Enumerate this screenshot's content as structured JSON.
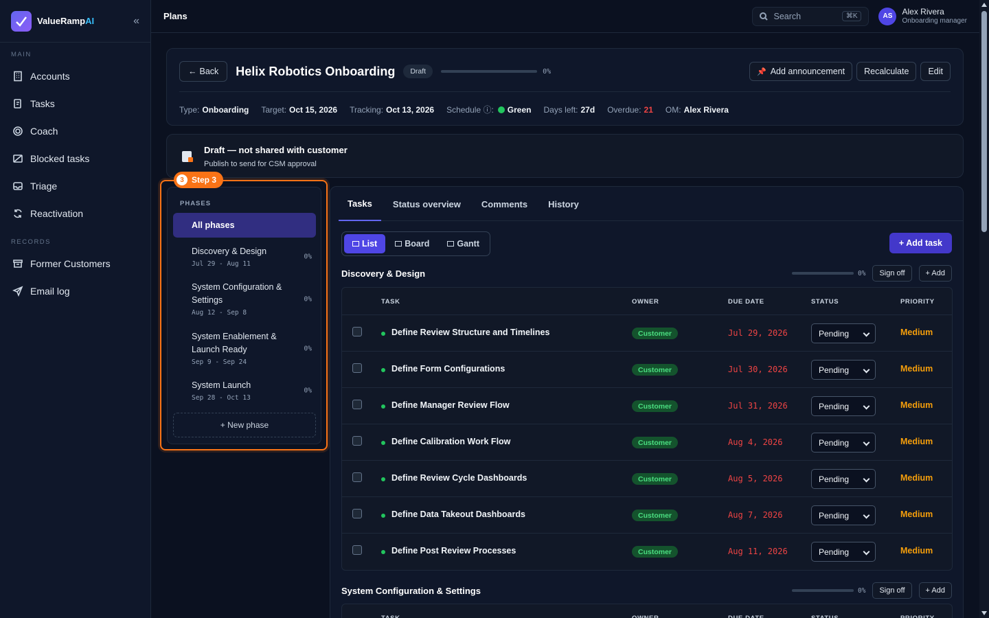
{
  "brand": {
    "name": "ValueRamp",
    "suffix": "AI"
  },
  "sidebar": {
    "section_main": "MAIN",
    "main_items": [
      {
        "label": "Accounts",
        "icon": "building-icon"
      },
      {
        "label": "Tasks",
        "icon": "clipboard-icon"
      },
      {
        "label": "Coach",
        "icon": "target-icon"
      },
      {
        "label": "Blocked tasks",
        "icon": "blocked-icon"
      },
      {
        "label": "Triage",
        "icon": "inbox-icon"
      },
      {
        "label": "Reactivation",
        "icon": "refresh-icon"
      }
    ],
    "section_records": "RECORDS",
    "record_items": [
      {
        "label": "Former Customers",
        "icon": "archive-icon"
      },
      {
        "label": "Email log",
        "icon": "send-icon"
      }
    ]
  },
  "topbar": {
    "title": "Plans",
    "search_placeholder": "Search",
    "search_shortcut": "⌘K",
    "user": {
      "initials": "AS",
      "name": "Alex Rivera",
      "role": "Onboarding manager"
    }
  },
  "plan": {
    "back_label": "Back",
    "title": "Helix Robotics Onboarding",
    "status": "Draft",
    "progress": "0%",
    "actions": {
      "announce": "Add announcement",
      "recalc": "Recalculate",
      "edit": "Edit"
    },
    "meta": {
      "type_label": "Type:",
      "type": "Onboarding",
      "target_label": "Target:",
      "target": "Oct 15, 2026",
      "tracking_label": "Tracking:",
      "tracking": "Oct 13, 2026",
      "schedule_label": "Schedule ⓘ:",
      "schedule": "Green",
      "days_left_label": "Days left:",
      "days_left": "27d",
      "overdue_label": "Overdue:",
      "overdue": "21",
      "om_label": "OM:",
      "om": "Alex Rivera"
    }
  },
  "banner": {
    "title": "Draft — not shared with customer",
    "subtitle": "Publish to send for CSM approval"
  },
  "step": {
    "num": "3",
    "label": "Step 3"
  },
  "phases": {
    "heading": "PHASES",
    "all": "All phases",
    "items": [
      {
        "name": "Discovery & Design",
        "dates": "Jul 29 - Aug 11",
        "pct": "0%"
      },
      {
        "name": "System Configuration & Settings",
        "dates": "Aug 12 - Sep 8",
        "pct": "0%"
      },
      {
        "name": "System Enablement & Launch Ready",
        "dates": "Sep 9 - Sep 24",
        "pct": "0%"
      },
      {
        "name": "System Launch",
        "dates": "Sep 28 - Oct 13",
        "pct": "0%"
      }
    ],
    "new_phase": "+ New phase"
  },
  "tabs": [
    "Tasks",
    "Status overview",
    "Comments",
    "History"
  ],
  "views": [
    "List",
    "Board",
    "Gantt"
  ],
  "add_task": "+ Add task",
  "columns": {
    "task": "TASK",
    "owner": "OWNER",
    "due": "DUE DATE",
    "status": "STATUS",
    "priority": "PRIORITY"
  },
  "groups": [
    {
      "title": "Discovery & Design",
      "pct": "0%",
      "sign_off": "Sign off",
      "add": "+ Add",
      "tasks": [
        {
          "name": "Define Review Structure and Timelines",
          "owner": "Customer",
          "due": "Jul 29, 2026",
          "status": "Pending",
          "priority": "Medium"
        },
        {
          "name": "Define Form Configurations",
          "owner": "Customer",
          "due": "Jul 30, 2026",
          "status": "Pending",
          "priority": "Medium"
        },
        {
          "name": "Define Manager Review Flow",
          "owner": "Customer",
          "due": "Jul 31, 2026",
          "status": "Pending",
          "priority": "Medium"
        },
        {
          "name": "Define Calibration Work Flow",
          "owner": "Customer",
          "due": "Aug 4, 2026",
          "status": "Pending",
          "priority": "Medium"
        },
        {
          "name": "Define Review Cycle Dashboards",
          "owner": "Customer",
          "due": "Aug 5, 2026",
          "status": "Pending",
          "priority": "Medium"
        },
        {
          "name": "Define Data Takeout Dashboards",
          "owner": "Customer",
          "due": "Aug 7, 2026",
          "status": "Pending",
          "priority": "Medium"
        },
        {
          "name": "Define Post Review Processes",
          "owner": "Customer",
          "due": "Aug 11, 2026",
          "status": "Pending",
          "priority": "Medium"
        }
      ]
    },
    {
      "title": "System Configuration & Settings",
      "pct": "0%",
      "sign_off": "Sign off",
      "add": "+ Add"
    }
  ]
}
